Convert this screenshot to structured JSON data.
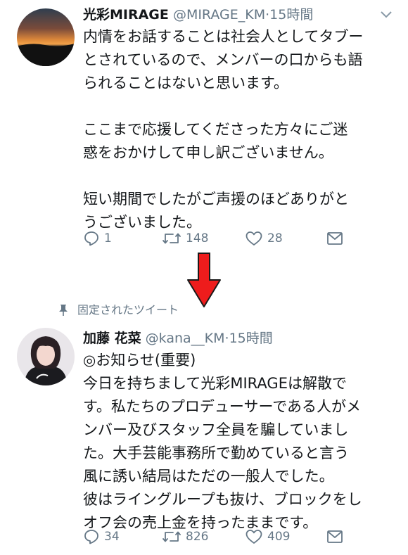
{
  "tweets": [
    {
      "name": "光彩MIRAGE",
      "handle": "@MIRAGE_KM",
      "dot": "·",
      "time": "15時間",
      "lines": [
        "内情をお話することは社会人としてタブー",
        "とされているので、メンバーの口からも語",
        "られることはないと思います。",
        "",
        "ここまで応援してくださった方々にご迷",
        "惑をおかけして申し訳ございません。",
        "",
        "短い期間でしたがご声援のほどありがと",
        "うございました。"
      ],
      "actions": {
        "reply": "1",
        "retweet": "148",
        "like": "28"
      }
    },
    {
      "pinned_label": "固定されたツイート",
      "name": "加藤 花菜",
      "handle": "@kana__KM",
      "dot": "·",
      "time": "15時間",
      "lines": [
        "◎お知らせ(重要)",
        "今日を持ちまして光彩MIRAGEは解散で",
        "す。私たちのプロデューサーである人がメ",
        "ンバー及びスタッフ全員を騙していまし",
        "た。大手芸能事務所で勤めていると言う",
        "風に誘い結局はただの一般人でした。",
        "彼はライングループも抜け、ブロックをし",
        "オフ会の売上金を持ったままです。"
      ],
      "actions": {
        "reply": "34",
        "retweet": "826",
        "like": "409"
      }
    }
  ],
  "icons": {
    "reply": "reply-icon",
    "retweet": "retweet-icon",
    "like": "heart-icon",
    "dm": "envelope-icon",
    "caret": "chevron-down-icon",
    "pin": "pin-icon",
    "arrow": "red-down-arrow-icon"
  },
  "colors": {
    "text": "#14171a",
    "secondary": "#657786",
    "arrow": "#ee1c1c"
  }
}
